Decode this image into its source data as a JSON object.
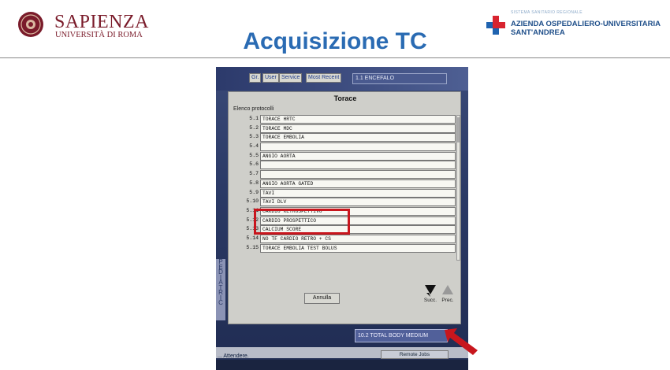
{
  "header": {
    "university_name": "SAPIENZA",
    "university_sub": "UNIVERSITÀ DI ROMA",
    "title": "Acquisizione TC",
    "hospital_small": "SISTEMA SANITARIO REGIONALE",
    "hospital_line1": "AZIENDA OSPEDALIERO-UNIVERSITARIA",
    "hospital_line2": "SANT'ANDREA",
    "brand_color": "#7a1b2a",
    "title_color": "#2a6bb3"
  },
  "screen": {
    "tabs": [
      "Gr.",
      "User",
      "Service",
      "Most Recent"
    ],
    "top_field": "1.1 ENCEFALO",
    "side_letters": [
      "P",
      "E",
      "D",
      "I",
      "A",
      "T",
      "R",
      "I",
      "C"
    ],
    "bottom_field": "10.2 TOTAL BODY MEDIUM",
    "status_text": "... Attendere.",
    "remote_jobs": "Remote Jobs"
  },
  "dialog": {
    "title": "Torace",
    "list_label": "Elenco protocolli",
    "rows": [
      {
        "num": "5.1",
        "name": "TORACE HRTC"
      },
      {
        "num": "5.2",
        "name": "TORACE MDC"
      },
      {
        "num": "5.3",
        "name": "TORACE EMBOLIA"
      },
      {
        "num": "5.4",
        "name": ""
      },
      {
        "num": "5.5",
        "name": "ANGIO AORTA"
      },
      {
        "num": "5.6",
        "name": ""
      },
      {
        "num": "5.7",
        "name": ""
      },
      {
        "num": "5.8",
        "name": "ANGIO AORTA GATED"
      },
      {
        "num": "5.9",
        "name": "TAVI"
      },
      {
        "num": "5.10",
        "name": "TAVI DLV"
      },
      {
        "num": "5.11",
        "name": "CARDIO RETROSPETTIVO"
      },
      {
        "num": "5.12",
        "name": "CARDIO PROSPETTICO"
      },
      {
        "num": "5.13",
        "name": "CALCIUM SCORE"
      },
      {
        "num": "5.14",
        "name": "NO TF CARDIO RETRO + CS"
      },
      {
        "num": "5.15",
        "name": "TORACE EMBOLIA TEST BOLUS"
      }
    ],
    "cancel_label": "Annulla",
    "next_label": "Succ.",
    "prev_label": "Prec."
  },
  "annotation": {
    "highlight_color": "#c8161d",
    "highlighted_rows": [
      "5.11",
      "5.12"
    ],
    "arrow_icon": "red-arrow-icon"
  }
}
